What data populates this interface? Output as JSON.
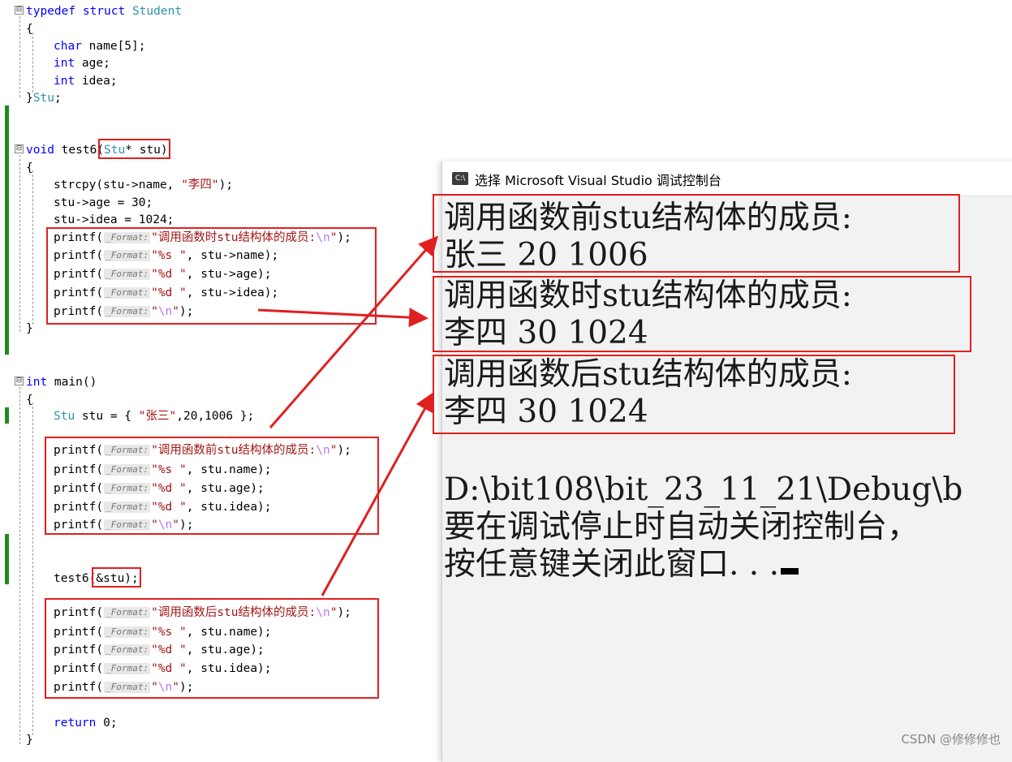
{
  "editor": {
    "lines": [
      {
        "parts": [
          {
            "t": "typedef struct ",
            "c": "kw"
          },
          {
            "t": "Student",
            "c": "ty"
          }
        ]
      },
      {
        "parts": [
          {
            "t": "{",
            "c": ""
          }
        ]
      },
      {
        "parts": [
          {
            "t": "char",
            "c": "kw"
          },
          {
            "t": " name[5];",
            "c": ""
          }
        ]
      },
      {
        "parts": [
          {
            "t": "int",
            "c": "kw"
          },
          {
            "t": " age;",
            "c": ""
          }
        ]
      },
      {
        "parts": [
          {
            "t": "int",
            "c": "kw"
          },
          {
            "t": " idea;",
            "c": ""
          }
        ]
      },
      {
        "parts": [
          {
            "t": "}",
            "c": ""
          },
          {
            "t": "Stu",
            "c": "ty"
          },
          {
            "t": ";",
            "c": ""
          }
        ]
      },
      {
        "parts": [
          {
            "t": "void",
            "c": "kw"
          },
          {
            "t": " test6(",
            "c": ""
          },
          {
            "t": "Stu",
            "c": "ty"
          },
          {
            "t": "* stu)",
            "c": ""
          }
        ]
      },
      {
        "parts": [
          {
            "t": "{",
            "c": ""
          }
        ]
      },
      {
        "parts": [
          {
            "t": "strcpy(stu->name, ",
            "c": ""
          },
          {
            "t": "\"李四\"",
            "c": "str"
          },
          {
            "t": ");",
            "c": ""
          }
        ]
      },
      {
        "parts": [
          {
            "t": "stu->age = 30;",
            "c": ""
          }
        ]
      },
      {
        "parts": [
          {
            "t": "stu->idea = 1024;",
            "c": ""
          }
        ]
      },
      {
        "parts": [
          {
            "t": "printf(",
            "c": ""
          },
          {
            "t": "_Format:",
            "c": "hint"
          },
          {
            "t": "\"调用函数时stu结构体的成员:",
            "c": "str"
          },
          {
            "t": "\\n",
            "c": "esc"
          },
          {
            "t": "\"",
            "c": "str"
          },
          {
            "t": ");",
            "c": ""
          }
        ]
      },
      {
        "parts": [
          {
            "t": "printf(",
            "c": ""
          },
          {
            "t": "_Format:",
            "c": "hint"
          },
          {
            "t": "\"%s \"",
            "c": "str"
          },
          {
            "t": ", stu->name);",
            "c": ""
          }
        ]
      },
      {
        "parts": [
          {
            "t": "printf(",
            "c": ""
          },
          {
            "t": "_Format:",
            "c": "hint"
          },
          {
            "t": "\"%d \"",
            "c": "str"
          },
          {
            "t": ", stu->age);",
            "c": ""
          }
        ]
      },
      {
        "parts": [
          {
            "t": "printf(",
            "c": ""
          },
          {
            "t": "_Format:",
            "c": "hint"
          },
          {
            "t": "\"%d \"",
            "c": "str"
          },
          {
            "t": ", stu->idea);",
            "c": ""
          }
        ]
      },
      {
        "parts": [
          {
            "t": "printf(",
            "c": ""
          },
          {
            "t": "_Format:",
            "c": "hint"
          },
          {
            "t": "\"",
            "c": "str"
          },
          {
            "t": "\\n",
            "c": "esc"
          },
          {
            "t": "\"",
            "c": "str"
          },
          {
            "t": ");",
            "c": ""
          }
        ]
      },
      {
        "parts": [
          {
            "t": "}",
            "c": ""
          }
        ]
      },
      {
        "parts": [
          {
            "t": "int",
            "c": "kw"
          },
          {
            "t": " main()",
            "c": ""
          }
        ]
      },
      {
        "parts": [
          {
            "t": "{",
            "c": ""
          }
        ]
      },
      {
        "parts": [
          {
            "t": "Stu",
            "c": "ty"
          },
          {
            "t": " stu = { ",
            "c": ""
          },
          {
            "t": "\"张三\"",
            "c": "str"
          },
          {
            "t": ",20,1006 };",
            "c": ""
          }
        ]
      },
      {
        "parts": [
          {
            "t": "printf(",
            "c": ""
          },
          {
            "t": "_Format:",
            "c": "hint"
          },
          {
            "t": "\"调用函数前stu结构体的成员:",
            "c": "str"
          },
          {
            "t": "\\n",
            "c": "esc"
          },
          {
            "t": "\"",
            "c": "str"
          },
          {
            "t": ");",
            "c": ""
          }
        ]
      },
      {
        "parts": [
          {
            "t": "printf(",
            "c": ""
          },
          {
            "t": "_Format:",
            "c": "hint"
          },
          {
            "t": "\"%s \"",
            "c": "str"
          },
          {
            "t": ", stu.name);",
            "c": ""
          }
        ]
      },
      {
        "parts": [
          {
            "t": "printf(",
            "c": ""
          },
          {
            "t": "_Format:",
            "c": "hint"
          },
          {
            "t": "\"%d \"",
            "c": "str"
          },
          {
            "t": ", stu.age);",
            "c": ""
          }
        ]
      },
      {
        "parts": [
          {
            "t": "printf(",
            "c": ""
          },
          {
            "t": "_Format:",
            "c": "hint"
          },
          {
            "t": "\"%d \"",
            "c": "str"
          },
          {
            "t": ", stu.idea);",
            "c": ""
          }
        ]
      },
      {
        "parts": [
          {
            "t": "printf(",
            "c": ""
          },
          {
            "t": "_Format:",
            "c": "hint"
          },
          {
            "t": "\"",
            "c": "str"
          },
          {
            "t": "\\n",
            "c": "esc"
          },
          {
            "t": "\"",
            "c": "str"
          },
          {
            "t": ");",
            "c": ""
          }
        ]
      },
      {
        "parts": [
          {
            "t": "test6(&stu);",
            "c": ""
          }
        ]
      },
      {
        "parts": [
          {
            "t": "printf(",
            "c": ""
          },
          {
            "t": "_Format:",
            "c": "hint"
          },
          {
            "t": "\"调用函数后stu结构体的成员:",
            "c": "str"
          },
          {
            "t": "\\n",
            "c": "esc"
          },
          {
            "t": "\"",
            "c": "str"
          },
          {
            "t": ");",
            "c": ""
          }
        ]
      },
      {
        "parts": [
          {
            "t": "printf(",
            "c": ""
          },
          {
            "t": "_Format:",
            "c": "hint"
          },
          {
            "t": "\"%s \"",
            "c": "str"
          },
          {
            "t": ", stu.name);",
            "c": ""
          }
        ]
      },
      {
        "parts": [
          {
            "t": "printf(",
            "c": ""
          },
          {
            "t": "_Format:",
            "c": "hint"
          },
          {
            "t": "\"%d \"",
            "c": "str"
          },
          {
            "t": ", stu.age);",
            "c": ""
          }
        ]
      },
      {
        "parts": [
          {
            "t": "printf(",
            "c": ""
          },
          {
            "t": "_Format:",
            "c": "hint"
          },
          {
            "t": "\"%d \"",
            "c": "str"
          },
          {
            "t": ", stu.idea);",
            "c": ""
          }
        ]
      },
      {
        "parts": [
          {
            "t": "printf(",
            "c": ""
          },
          {
            "t": "_Format:",
            "c": "hint"
          },
          {
            "t": "\"",
            "c": "str"
          },
          {
            "t": "\\n",
            "c": "esc"
          },
          {
            "t": "\"",
            "c": "str"
          },
          {
            "t": ");",
            "c": ""
          }
        ]
      },
      {
        "parts": [
          {
            "t": "return",
            "c": "kw"
          },
          {
            "t": " 0;",
            "c": ""
          }
        ]
      },
      {
        "parts": [
          {
            "t": "}",
            "c": ""
          }
        ]
      }
    ],
    "fold_glyph": "⊟",
    "colors": {
      "keyword": "#0000ff",
      "type": "#2b91af",
      "string": "#a31515",
      "escape": "#b776fb",
      "change_bar": "#1e8a1e",
      "annotation": "#e02020"
    }
  },
  "console": {
    "title": "选择 Microsoft Visual Studio 调试控制台",
    "icon_label": "C:\\",
    "lines": [
      "调用函数前stu结构体的成员:",
      "张三 20 1006",
      "调用函数时stu结构体的成员:",
      "李四 30 1024",
      "调用函数后stu结构体的成员:",
      "李四 30 1024",
      "",
      "D:\\bit108\\bit_23_11_21\\Debug\\b",
      "要在调试停止时自动关闭控制台，",
      "按任意键关闭此窗口. . ."
    ]
  },
  "watermark": "CSDN @修修修也"
}
